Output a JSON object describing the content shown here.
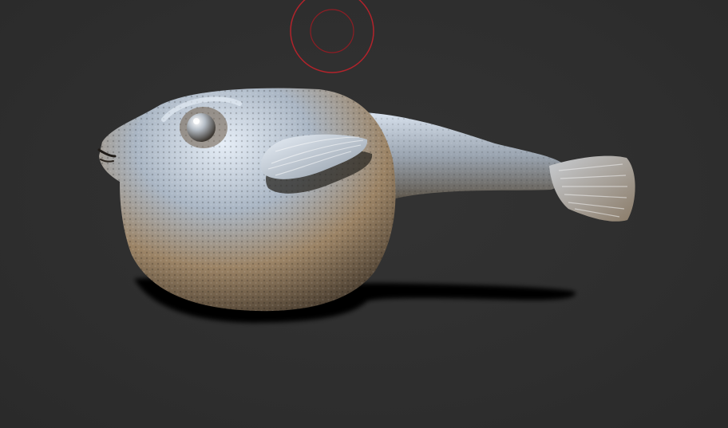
{
  "viewport": {
    "background_color": "#2f2f2f"
  },
  "brush_cursor": {
    "color": "#b3232b",
    "icon": "brush-cursor-icon"
  },
  "model": {
    "subject": "pufferfish-sculpt",
    "material_highlight": "#dfe9f5",
    "material_mid": "#9aa6b4",
    "material_warm": "#b08a62",
    "material_shadow": "#3a3228"
  }
}
